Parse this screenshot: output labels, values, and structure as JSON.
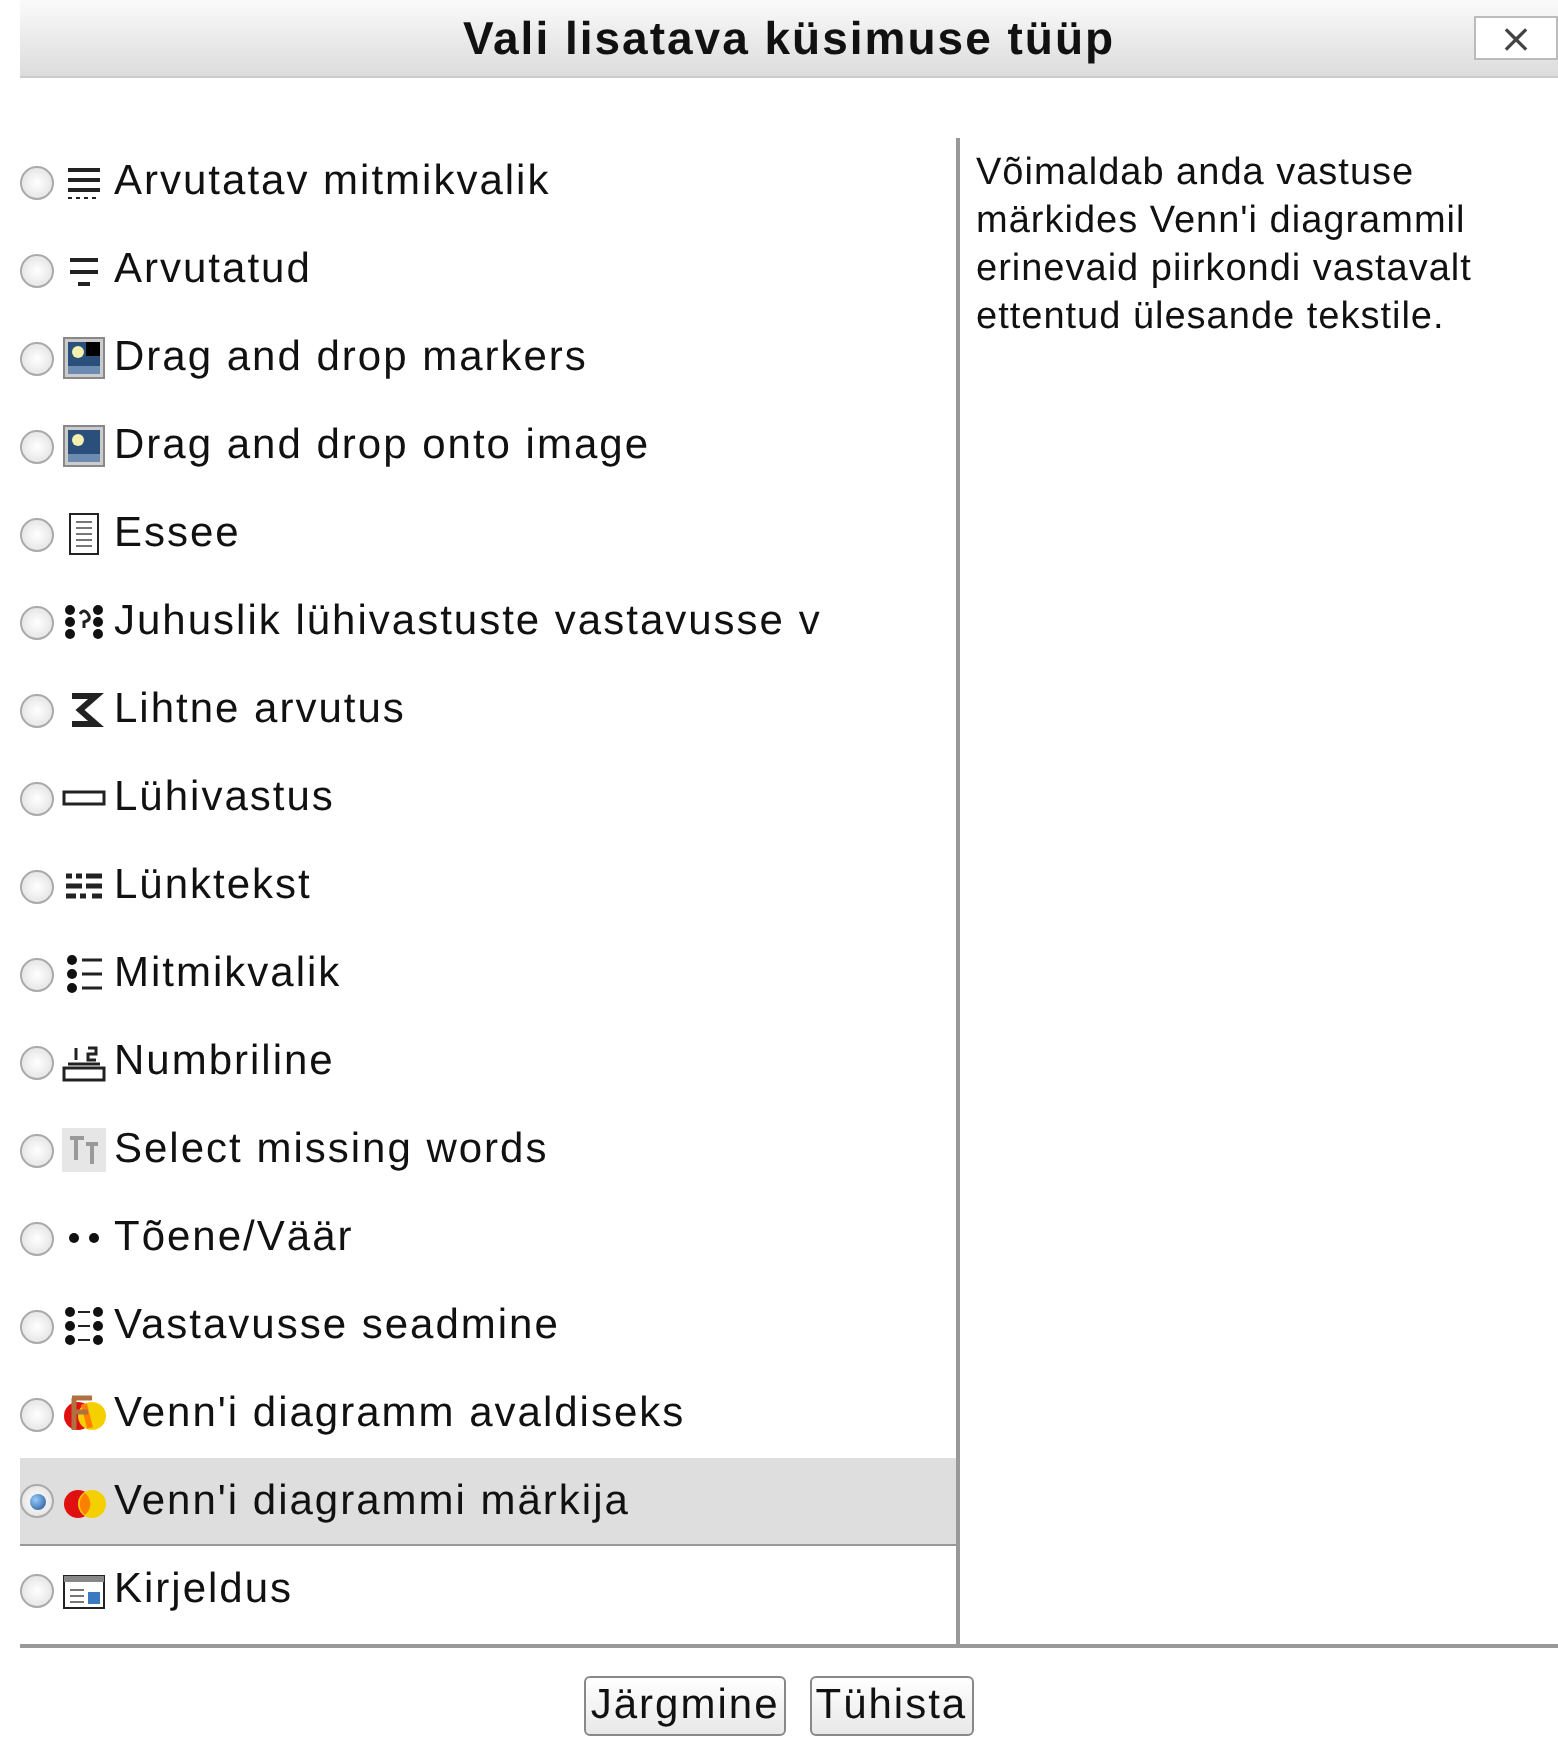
{
  "window": {
    "title": "Vali lisatava küsimuse tüüp",
    "close": "×"
  },
  "items": [
    {
      "label": "Arvutatav mitmikvalik",
      "selected": false
    },
    {
      "label": "Arvutatud",
      "selected": false
    },
    {
      "label": "Drag and drop markers",
      "selected": false
    },
    {
      "label": "Drag and drop onto image",
      "selected": false
    },
    {
      "label": "Essee",
      "selected": false
    },
    {
      "label": "Juhuslik lühivastuste vastavusse v",
      "selected": false
    },
    {
      "label": "Lihtne arvutus",
      "selected": false
    },
    {
      "label": "Lühivastus",
      "selected": false
    },
    {
      "label": "Lünktekst",
      "selected": false
    },
    {
      "label": "Mitmikvalik",
      "selected": false
    },
    {
      "label": "Numbriline",
      "selected": false
    },
    {
      "label": "Select missing words",
      "selected": false
    },
    {
      "label": "Tõene/Väär",
      "selected": false
    },
    {
      "label": "Vastavusse seadmine",
      "selected": false
    },
    {
      "label": "Venn'i diagramm avaldiseks",
      "selected": false
    },
    {
      "label": "Venn'i diagrammi märkija",
      "selected": true
    },
    {
      "label": "Kirjeldus",
      "selected": false
    }
  ],
  "description": "Võimaldab anda vastuse märkides Venn'i diagrammil erinevaid piirkondi vastavalt ettentud ülesande tekstile.",
  "buttons": [
    "Järgmine",
    "Tühista"
  ]
}
